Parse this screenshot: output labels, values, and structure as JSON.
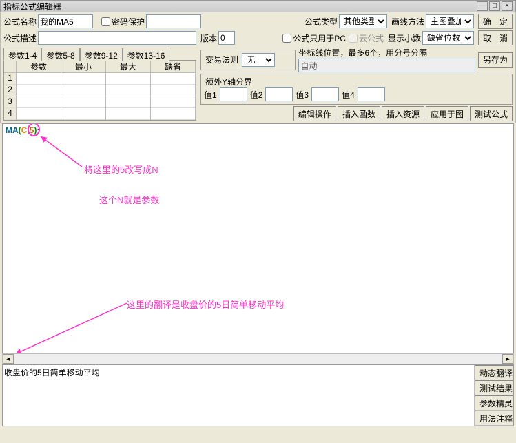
{
  "title": "指标公式编辑器",
  "row1": {
    "name_lbl": "公式名称",
    "name_val": "我的MA5",
    "pwd_lbl": "密码保护",
    "type_lbl": "公式类型",
    "type_val": "其他类型",
    "draw_lbl": "画线方法",
    "draw_val": "主图叠加",
    "ok": "确　定"
  },
  "row2": {
    "desc_lbl": "公式描述",
    "ver_lbl": "版本",
    "ver_val": "0",
    "pc_lbl": "公式只用于PC",
    "cloud_lbl": "云公式",
    "dec_lbl": "显示小数",
    "dec_val": "缺省位数",
    "cancel": "取　消"
  },
  "tabs": [
    "参数1-4",
    "参数5-8",
    "参数9-12",
    "参数13-16"
  ],
  "param_headers": [
    "参数",
    "最小",
    "最大",
    "缺省"
  ],
  "param_rows": [
    "1",
    "2",
    "3",
    "4"
  ],
  "trade": {
    "legend": "交易法则",
    "pos_lbl": "坐标线位置，最多6个，用分号分隔",
    "none": "无",
    "auto": "自动"
  },
  "yaxis": {
    "legend": "额外Y轴分界",
    "v1": "值1",
    "v2": "值2",
    "v3": "值3",
    "v4": "值4"
  },
  "save_as": "另存为",
  "opbtns": [
    "编辑操作",
    "插入函数",
    "插入资源",
    "应用于图",
    "测试公式"
  ],
  "code": {
    "ma": "MA",
    "c": "C",
    "n": "5"
  },
  "annotations": {
    "a1": "将这里的5改写成N",
    "a2": "这个N就是参数",
    "a3": "这里的翻译是收盘价的5日简单移动平均"
  },
  "bottom_text": "收盘价的5日简单移动平均",
  "bottom_btns": [
    "动态翻译",
    "测试结果",
    "参数精灵",
    "用法注释"
  ]
}
